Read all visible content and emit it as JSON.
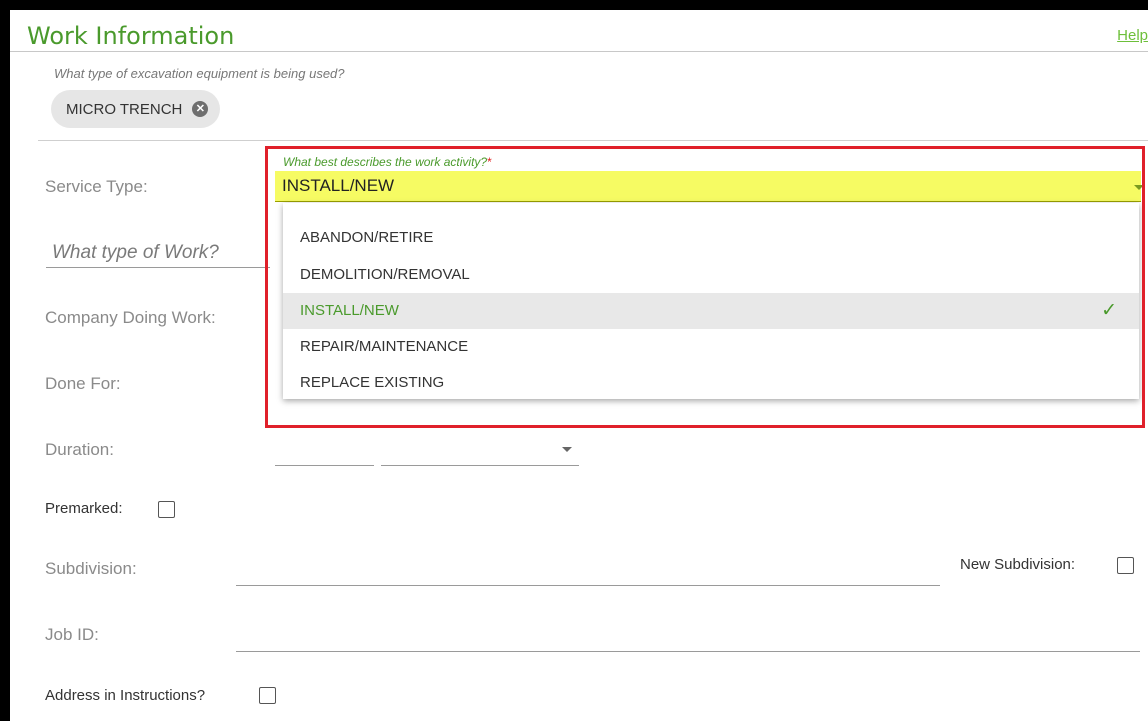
{
  "header": {
    "title": "Work Information",
    "help_label": "Help"
  },
  "equipment": {
    "question": "What type of excavation equipment is being used?",
    "chip_label": "MICRO TRENCH"
  },
  "form": {
    "service_type_label": "Service Type:",
    "work_type_placeholder": "What type of Work?",
    "company_label": "Company Doing Work:",
    "done_for_label": "Done For:",
    "duration_label": "Duration:",
    "premarked_label": "Premarked:",
    "subdivision_label": "Subdivision:",
    "new_subdivision_label": "New Subdivision:",
    "job_id_label": "Job ID:",
    "address_label": "Address in Instructions?"
  },
  "activity": {
    "label": "What best describes the work activity?",
    "required_mark": "*",
    "selected_value": "INSTALL/NEW",
    "options": [
      {
        "label": "ABANDON/RETIRE",
        "selected": false
      },
      {
        "label": "DEMOLITION/REMOVAL",
        "selected": false
      },
      {
        "label": "INSTALL/NEW",
        "selected": true
      },
      {
        "label": "REPAIR/MAINTENANCE",
        "selected": false
      },
      {
        "label": "REPLACE EXISTING",
        "selected": false
      }
    ],
    "check_icon": "check-icon"
  },
  "colors": {
    "accent": "#4a9a2c",
    "highlight_field": "#f6fb63",
    "annotation_box": "#e0202a"
  }
}
